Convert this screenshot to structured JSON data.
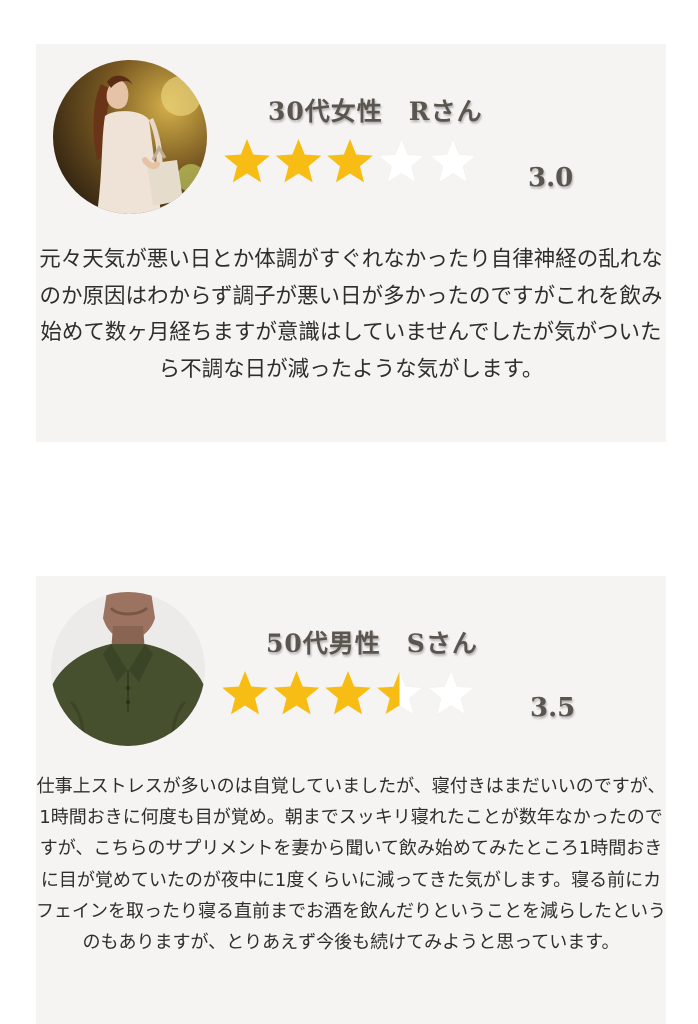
{
  "reviews": [
    {
      "avatar_icon": "woman-in-white-dress-photo",
      "reviewer": "30代女性　Rさん",
      "rating": 3.0,
      "rating_max": 5,
      "rating_label": "3.0",
      "text": "元々天気が悪い日とか体調がすぐれなかったり自律神経の乱れなのか原因はわからず調子が悪い日が多かったのですがこれを飲み始めて数ヶ月経ちますが意識はしていませんでしたが気がついたら不調な日が減ったような気がします。"
    },
    {
      "avatar_icon": "man-in-green-polo-photo",
      "reviewer": "50代男性　Sさん",
      "rating": 3.5,
      "rating_max": 5,
      "rating_label": "3.5",
      "text": "仕事上ストレスが多いのは自覚していましたが、寝付きはまだいいのですが、1時間おきに何度も目が覚め。朝までスッキリ寝れたことが数年なかったのですが、こちらのサプリメントを妻から聞いて飲み始めてみたところ1時間おきに目が覚めていたのが夜中に1度くらいに減ってきた気がします。寝る前にカフェインを取ったり寝る直前までお酒を飲んだりということを減らしたというのもありますが、とりあえず今後も続けてみようと思っています。"
    }
  ],
  "colors": {
    "star_filled": "#f7bd15",
    "star_empty": "#ffffff",
    "card_bg": "#f5f4f3",
    "title_text": "#5a554e"
  }
}
